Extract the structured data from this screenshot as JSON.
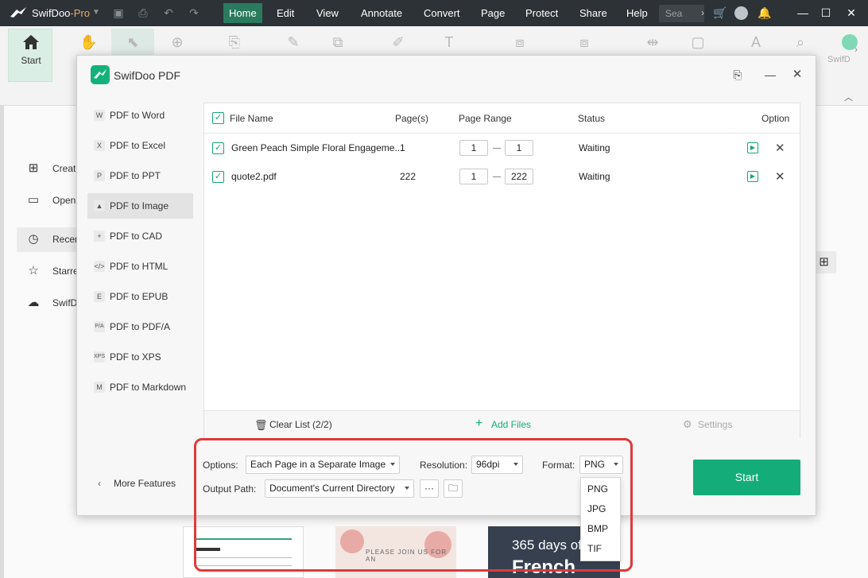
{
  "titlebar": {
    "app_name": "SwifDoo",
    "app_suffix": "-Pro",
    "menus": [
      "Home",
      "Edit",
      "View",
      "Annotate",
      "Convert",
      "Page",
      "Protect",
      "Share",
      "Help"
    ],
    "active_menu": "Home",
    "search_placeholder": "Sea"
  },
  "ribbon": {
    "start_label": "Start",
    "right_label": "SwifD"
  },
  "background": {
    "sidebar": [
      "Create",
      "Open",
      "Recen",
      "Starre",
      "SwifD"
    ],
    "thumb_text": "365 days of",
    "thumb_text2": "French",
    "thumb_invite": "PLEASE JOIN US FOR AN"
  },
  "dialog": {
    "title": "SwifDoo PDF",
    "side_items": [
      {
        "icon": "W",
        "label": "PDF to Word"
      },
      {
        "icon": "X",
        "label": "PDF to Excel"
      },
      {
        "icon": "P",
        "label": "PDF to PPT"
      },
      {
        "icon": "▲",
        "label": "PDF to Image"
      },
      {
        "icon": "+",
        "label": "PDF to CAD"
      },
      {
        "icon": "</>",
        "label": "PDF to HTML"
      },
      {
        "icon": "E",
        "label": "PDF to EPUB"
      },
      {
        "icon": "P/A",
        "label": "PDF to PDF/A"
      },
      {
        "icon": "XPS",
        "label": "PDF to XPS"
      },
      {
        "icon": "M",
        "label": "PDF to Markdown"
      }
    ],
    "active_side_index": 3,
    "more_features": "More Features",
    "table": {
      "headers": [
        "File Name",
        "Page(s)",
        "Page Range",
        "Status",
        "Option"
      ],
      "rows": [
        {
          "name": "Green Peach Simple Floral Engageme...",
          "pages": "1",
          "from": "1",
          "to": "1",
          "status": "Waiting"
        },
        {
          "name": "quote2.pdf",
          "pages": "222",
          "from": "1",
          "to": "222",
          "status": "Waiting"
        }
      ]
    },
    "footer": {
      "clear_list": "Clear List (2/2)",
      "add_files": "Add Files",
      "settings": "Settings"
    },
    "options": {
      "options_label": "Options:",
      "options_value": "Each Page in a Separate Image",
      "resolution_label": "Resolution:",
      "resolution_value": "96dpi",
      "format_label": "Format:",
      "format_value": "PNG",
      "output_label": "Output Path:",
      "output_value": "Document's Current Directory",
      "more_btn": "···"
    },
    "format_options": [
      "PNG",
      "JPG",
      "BMP",
      "TIF"
    ],
    "start_button": "Start"
  },
  "colors": {
    "accent": "#14ad7a",
    "titlebar": "#2d3236",
    "highlight_box": "#e0393a"
  }
}
